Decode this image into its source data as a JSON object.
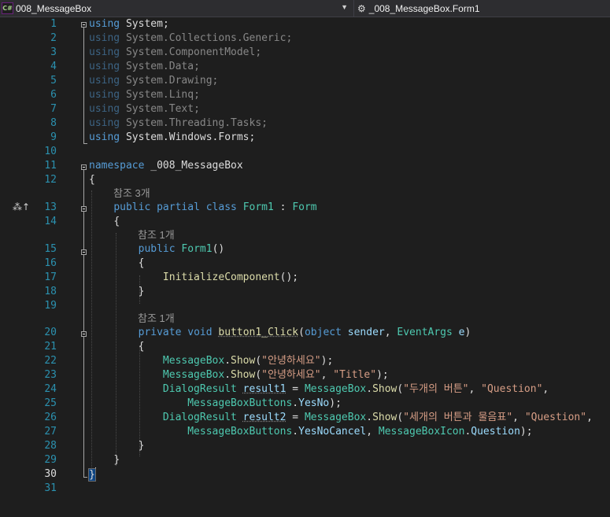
{
  "navbar": {
    "project": "008_MessageBox",
    "class_member": "_008_MessageBox.Form1",
    "project_icon": "csharp-project-icon",
    "class_icon": "class-icon"
  },
  "lines": {
    "n1": "1",
    "n2": "2",
    "n3": "3",
    "n4": "4",
    "n5": "5",
    "n6": "6",
    "n7": "7",
    "n8": "8",
    "n9": "9",
    "n10": "10",
    "n11": "11",
    "n12": "12",
    "n13": "13",
    "n14": "14",
    "n15": "15",
    "n16": "16",
    "n17": "17",
    "n18": "18",
    "n19": "19",
    "n20": "20",
    "n21": "21",
    "n22": "22",
    "n23": "23",
    "n24": "24",
    "n25": "25",
    "n26": "26",
    "n27": "27",
    "n28": "28",
    "n29": "29",
    "n30": "30",
    "n31": "31"
  },
  "code": {
    "using": "using",
    "system": "System",
    "u2_ns": "System.Collections.Generic",
    "u3_ns": "System.ComponentModel",
    "u4_ns": "System.Data",
    "u5_ns": "System.Drawing",
    "u6_ns": "System.Linq",
    "u7_ns": "System.Text",
    "u8_ns": "System.Threading.Tasks",
    "u9_ns": "System.Windows.Forms",
    "namespace_kw": "namespace",
    "namespace_name": "_008_MessageBox",
    "open_brace": "{",
    "close_brace": "}",
    "ref3": "참조 3개",
    "ref1": "참조 1개",
    "public": "public",
    "partial": "partial",
    "class": "class",
    "private": "private",
    "void": "void",
    "object": "object",
    "form1": "Form1",
    "form": "Form",
    "colon": " : ",
    "ctor_parens": "()",
    "init_call": "InitializeComponent",
    "call_end": "();",
    "button_click": "button1_Click",
    "sender": "sender",
    "eventargs": "EventArgs",
    "e": "e",
    "messagebox": "MessageBox",
    "show": "Show",
    "s_hello": "\"안녕하세요\"",
    "s_title": "\"Title\"",
    "s_two": "\"두개의 버튼\"",
    "s_question": "\"Question\"",
    "s_three": "\"세개의 버튼과 물음표\"",
    "dialogresult": "DialogResult",
    "result1": "result1",
    "result2": "result2",
    "mbbuttons": "MessageBoxButtons",
    "yesno": "YesNo",
    "yesnocancel": "YesNoCancel",
    "mbicon": "MessageBoxIcon",
    "question": "Question"
  }
}
